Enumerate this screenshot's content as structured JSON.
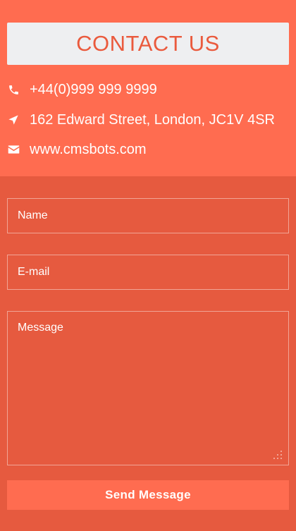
{
  "contact": {
    "title": "CONTACT US",
    "phone": {
      "icon": "phone-icon",
      "text": "+44(0)999 999 9999"
    },
    "address": {
      "icon": "location-arrow-icon",
      "text": "162 Edward Street, London, JC1V 4SR"
    },
    "website": {
      "icon": "envelope-icon",
      "text": "www.cmsbots.com"
    }
  },
  "form": {
    "name_placeholder": "Name",
    "email_placeholder": "E-mail",
    "message_placeholder": "Message",
    "send_label": "Send Message"
  },
  "colors": {
    "header_bg": "#ff6c50",
    "form_bg": "#e65a3f",
    "title_box_bg": "#eeeff1",
    "title_text": "#ea5a3d",
    "text": "#ffffff"
  }
}
